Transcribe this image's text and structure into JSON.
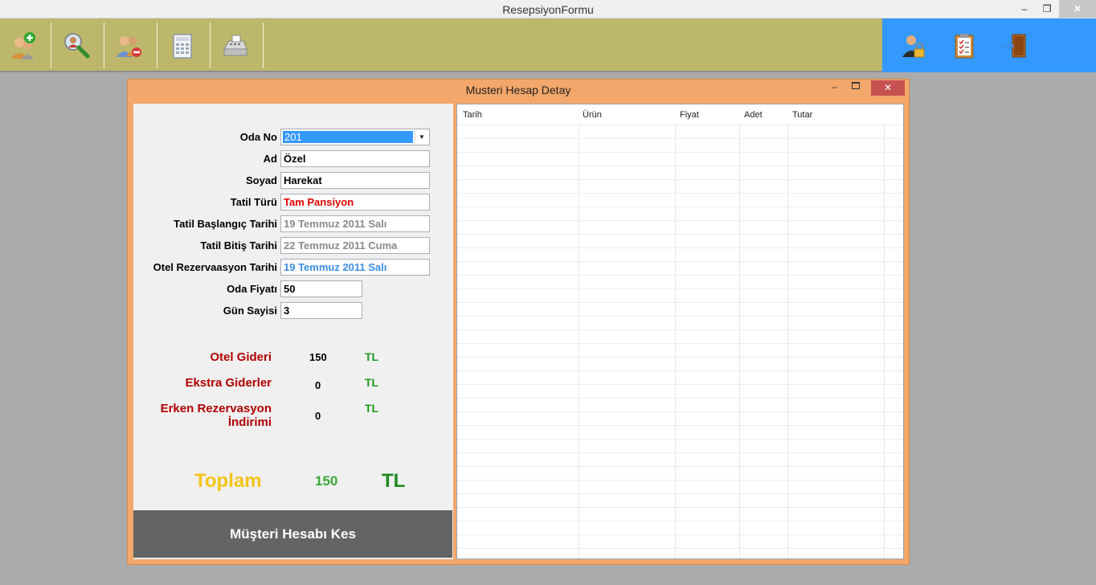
{
  "window": {
    "title": "ResepsiyonFormu",
    "minimize": "–",
    "maximize": "❐",
    "close": "✕"
  },
  "toolbar": {
    "buttons": [
      {
        "icon": "add-user-icon"
      },
      {
        "icon": "search-user-icon"
      },
      {
        "icon": "remove-user-icon"
      },
      {
        "icon": "calculator-icon"
      },
      {
        "icon": "cash-register-icon"
      }
    ],
    "right_buttons": [
      {
        "icon": "user-lock-icon"
      },
      {
        "icon": "clipboard-icon"
      },
      {
        "icon": "exit-door-icon"
      }
    ]
  },
  "child_window": {
    "title": "Musteri Hesap Detay",
    "minimize": "–",
    "close": "✕"
  },
  "form": {
    "oda_no": {
      "label": "Oda No",
      "value": "201",
      "dropdown": "▼"
    },
    "ad": {
      "label": "Ad",
      "value": "Özel"
    },
    "soyad": {
      "label": "Soyad",
      "value": "Harekat"
    },
    "tatil_turu": {
      "label": "Tatil Türü",
      "value": "Tam Pansiyon"
    },
    "tatil_baslangic": {
      "label": "Tatil Başlangıç  Tarihi",
      "value": "19 Temmuz 2011 Salı"
    },
    "tatil_bitis": {
      "label": "Tatil Bitiş Tarihi",
      "value": "22 Temmuz 2011 Cuma"
    },
    "otel_rezervasyon": {
      "label": "Otel Rezervaasyon Tarihi",
      "value": "19 Temmuz 2011 Salı"
    },
    "oda_fiyati": {
      "label": "Oda Fiyatı",
      "value": "50"
    },
    "gun_sayisi": {
      "label": "Gün Sayisi",
      "value": "3"
    }
  },
  "expenses": {
    "otel_gideri": {
      "label": "Otel Gideri",
      "value": "150",
      "currency": "TL"
    },
    "ekstra_giderler": {
      "label": "Ekstra Giderler",
      "value": "0",
      "currency": "TL"
    },
    "erken_rezervasyon": {
      "label_line1": "Erken Rezervasyon",
      "label_line2": "İndirimi",
      "value": "0",
      "currency": "TL"
    }
  },
  "total": {
    "label": "Toplam",
    "value": "150",
    "currency": "TL"
  },
  "action_button": {
    "label": "Müşteri Hesabı Kes"
  },
  "grid": {
    "columns": [
      "Tarih",
      "Ürün",
      "Fiyat",
      "Adet",
      "Tutar"
    ]
  }
}
